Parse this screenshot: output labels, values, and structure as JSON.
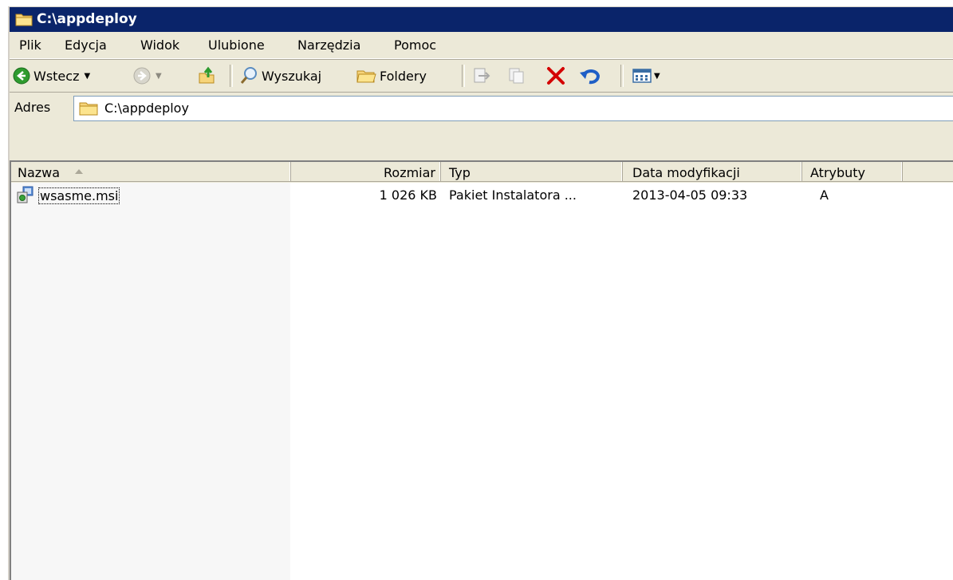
{
  "window": {
    "title": "C:\\appdeploy"
  },
  "menu": [
    {
      "label": "Plik"
    },
    {
      "label": "Edycja"
    },
    {
      "label": "Widok"
    },
    {
      "label": "Ulubione"
    },
    {
      "label": "Narzędzia"
    },
    {
      "label": "Pomoc"
    }
  ],
  "toolbar": {
    "back_label": "Wstecz",
    "search_label": "Wyszukaj",
    "folders_label": "Foldery"
  },
  "address": {
    "label": "Adres",
    "value": "C:\\appdeploy"
  },
  "columns": [
    {
      "label": "Nazwa"
    },
    {
      "label": "Rozmiar"
    },
    {
      "label": "Typ"
    },
    {
      "label": "Data modyfikacji"
    },
    {
      "label": "Atrybuty"
    }
  ],
  "files": [
    {
      "name": "wsasme.msi",
      "size": "1 026 KB",
      "type": "Pakiet Instalatora ...",
      "modified": "2013-04-05 09:33",
      "attributes": "A"
    }
  ],
  "colors": {
    "titlebar": "#0a246a",
    "chrome": "#ece9d8",
    "delete_red": "#d40000",
    "back_green": "#2e9b2e"
  }
}
